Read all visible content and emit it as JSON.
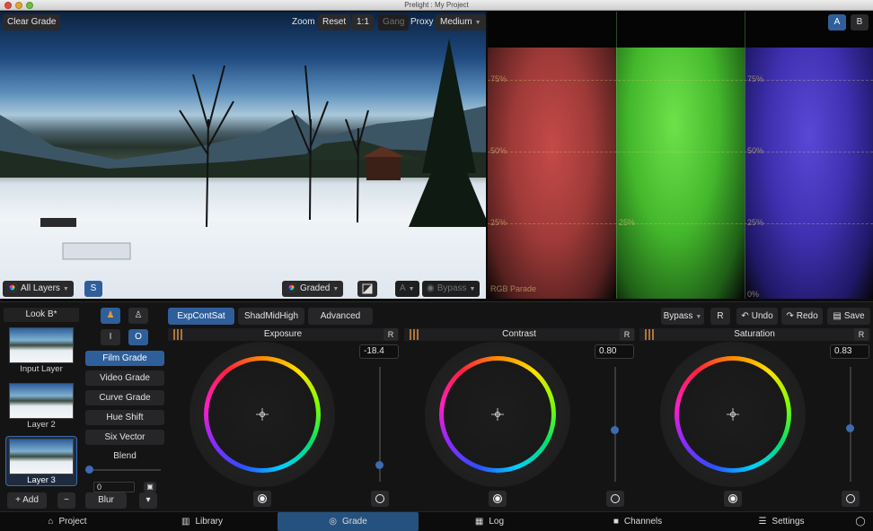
{
  "window": {
    "title": "Prelight : My Project"
  },
  "viewer": {
    "clear_grade": "Clear Grade",
    "zoom_label": "Zoom",
    "reset": "Reset",
    "one_to_one": "1:1",
    "gang": "Gang",
    "proxy_label": "Proxy",
    "proxy_value": "Medium",
    "all_layers": "All Layers",
    "solo": "S",
    "graded": "Graded",
    "a_select": "A",
    "bypass": "Bypass"
  },
  "scope": {
    "a": "A",
    "b": "B",
    "labels": [
      "75%",
      "50%",
      "25%",
      "0%"
    ],
    "parade_label": "RGB Parade"
  },
  "layers": {
    "title": "Look B*",
    "items": [
      "Input Layer",
      "Layer 2",
      "Layer 3"
    ],
    "add": "+ Add",
    "minus": "−",
    "blur": "Blur",
    "down": "▾"
  },
  "modes": {
    "i": "I",
    "o": "O",
    "buttons": [
      "Film Grade",
      "Video Grade",
      "Curve Grade",
      "Hue Shift",
      "Six Vector"
    ],
    "blend": "Blend",
    "blend_value": "0"
  },
  "tabs": [
    "ExpContSat",
    "ShadMidHigh",
    "Advanced"
  ],
  "toolbar": {
    "bypass": "Bypass",
    "r": "R",
    "undo": "Undo",
    "redo": "Redo",
    "save": "Save"
  },
  "controls": [
    {
      "name": "Exposure",
      "value": "-18.4",
      "reset": "R",
      "level": 0.15
    },
    {
      "name": "Contrast",
      "value": "0.80",
      "reset": "R",
      "level": 0.45
    },
    {
      "name": "Saturation",
      "value": "0.83",
      "reset": "R",
      "level": 0.47
    }
  ],
  "nav": [
    "Project",
    "Library",
    "Grade",
    "Log",
    "Channels",
    "Settings"
  ],
  "colors": {
    "accent": "#2f5f9a",
    "active_nav": "#25517f",
    "panel": "#141415"
  }
}
